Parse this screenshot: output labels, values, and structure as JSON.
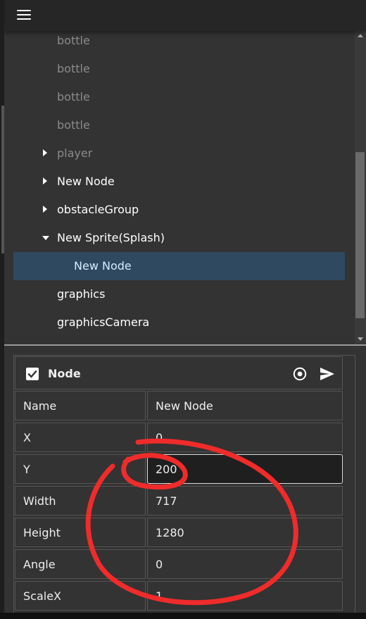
{
  "tree": {
    "items": [
      {
        "label": "bottle",
        "arrow": "",
        "dim": true
      },
      {
        "label": "bottle",
        "arrow": "",
        "dim": true
      },
      {
        "label": "bottle",
        "arrow": "",
        "dim": true
      },
      {
        "label": "bottle",
        "arrow": "",
        "dim": true
      },
      {
        "label": "player",
        "arrow": "right",
        "dim": true
      },
      {
        "label": "New Node",
        "arrow": "right",
        "dim": false
      },
      {
        "label": "obstacleGroup",
        "arrow": "right",
        "dim": false
      },
      {
        "label": "New Sprite(Splash)",
        "arrow": "down",
        "dim": false
      },
      {
        "label": "New Node",
        "arrow": "",
        "dim": false,
        "selected": true,
        "child": true
      },
      {
        "label": "graphics",
        "arrow": "",
        "dim": false
      },
      {
        "label": "graphicsCamera",
        "arrow": "",
        "dim": false
      }
    ]
  },
  "inspector": {
    "title": "Node",
    "enabled": true,
    "properties": [
      {
        "name": "Name",
        "value": "New Node"
      },
      {
        "name": "X",
        "value": "0"
      },
      {
        "name": "Y",
        "value": "200",
        "focused": true
      },
      {
        "name": "Width",
        "value": "717"
      },
      {
        "name": "Height",
        "value": "1280"
      },
      {
        "name": "Angle",
        "value": "0"
      },
      {
        "name": "ScaleX",
        "value": "1"
      }
    ]
  },
  "icons": {
    "menu": "hamburger-icon",
    "target": "target-icon",
    "send": "send-icon",
    "checkbox": "checkbox-checked-icon"
  },
  "colors": {
    "panel": "#333333",
    "topbar": "#262626",
    "selected_row": "#2f4a60",
    "selected_text": "#d6ecff",
    "dim_text": "#8a8a8a",
    "annotation": "#ef2b2b"
  }
}
